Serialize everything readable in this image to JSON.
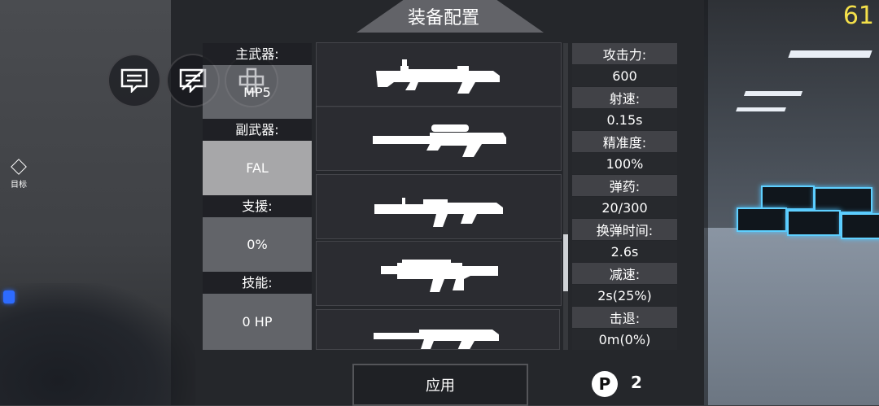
{
  "title": "装备配置",
  "fps": "61",
  "target_label": "目标",
  "loadout": [
    {
      "label": "主武器:",
      "value": "MP5",
      "selected": false
    },
    {
      "label": "副武器:",
      "value": "FAL",
      "selected": true
    },
    {
      "label": "支援:",
      "value": "0%",
      "selected": false
    },
    {
      "label": "技能:",
      "value": "0 HP",
      "selected": false
    }
  ],
  "weapons": [
    {
      "icon": "machine-gun-icon"
    },
    {
      "icon": "sniper-rifle-icon"
    },
    {
      "icon": "battle-rifle-icon"
    },
    {
      "icon": "assault-rifle-icon"
    },
    {
      "icon": "shotgun-icon"
    }
  ],
  "stats": [
    {
      "key": "攻击力:",
      "value": "600"
    },
    {
      "key": "射速:",
      "value": "0.15s"
    },
    {
      "key": "精准度:",
      "value": "100%"
    },
    {
      "key": "弹药:",
      "value": "20/300"
    },
    {
      "key": "换弹时间:",
      "value": "2.6s"
    },
    {
      "key": "减速:",
      "value": "2s(25%)"
    },
    {
      "key": "击退:",
      "value": "0m(0%)"
    }
  ],
  "apply_label": "应用",
  "currency_symbol": "P",
  "currency_count": "2",
  "colors": {
    "fps": "#f4e04a",
    "crate_glow": "#5fd0ff"
  }
}
